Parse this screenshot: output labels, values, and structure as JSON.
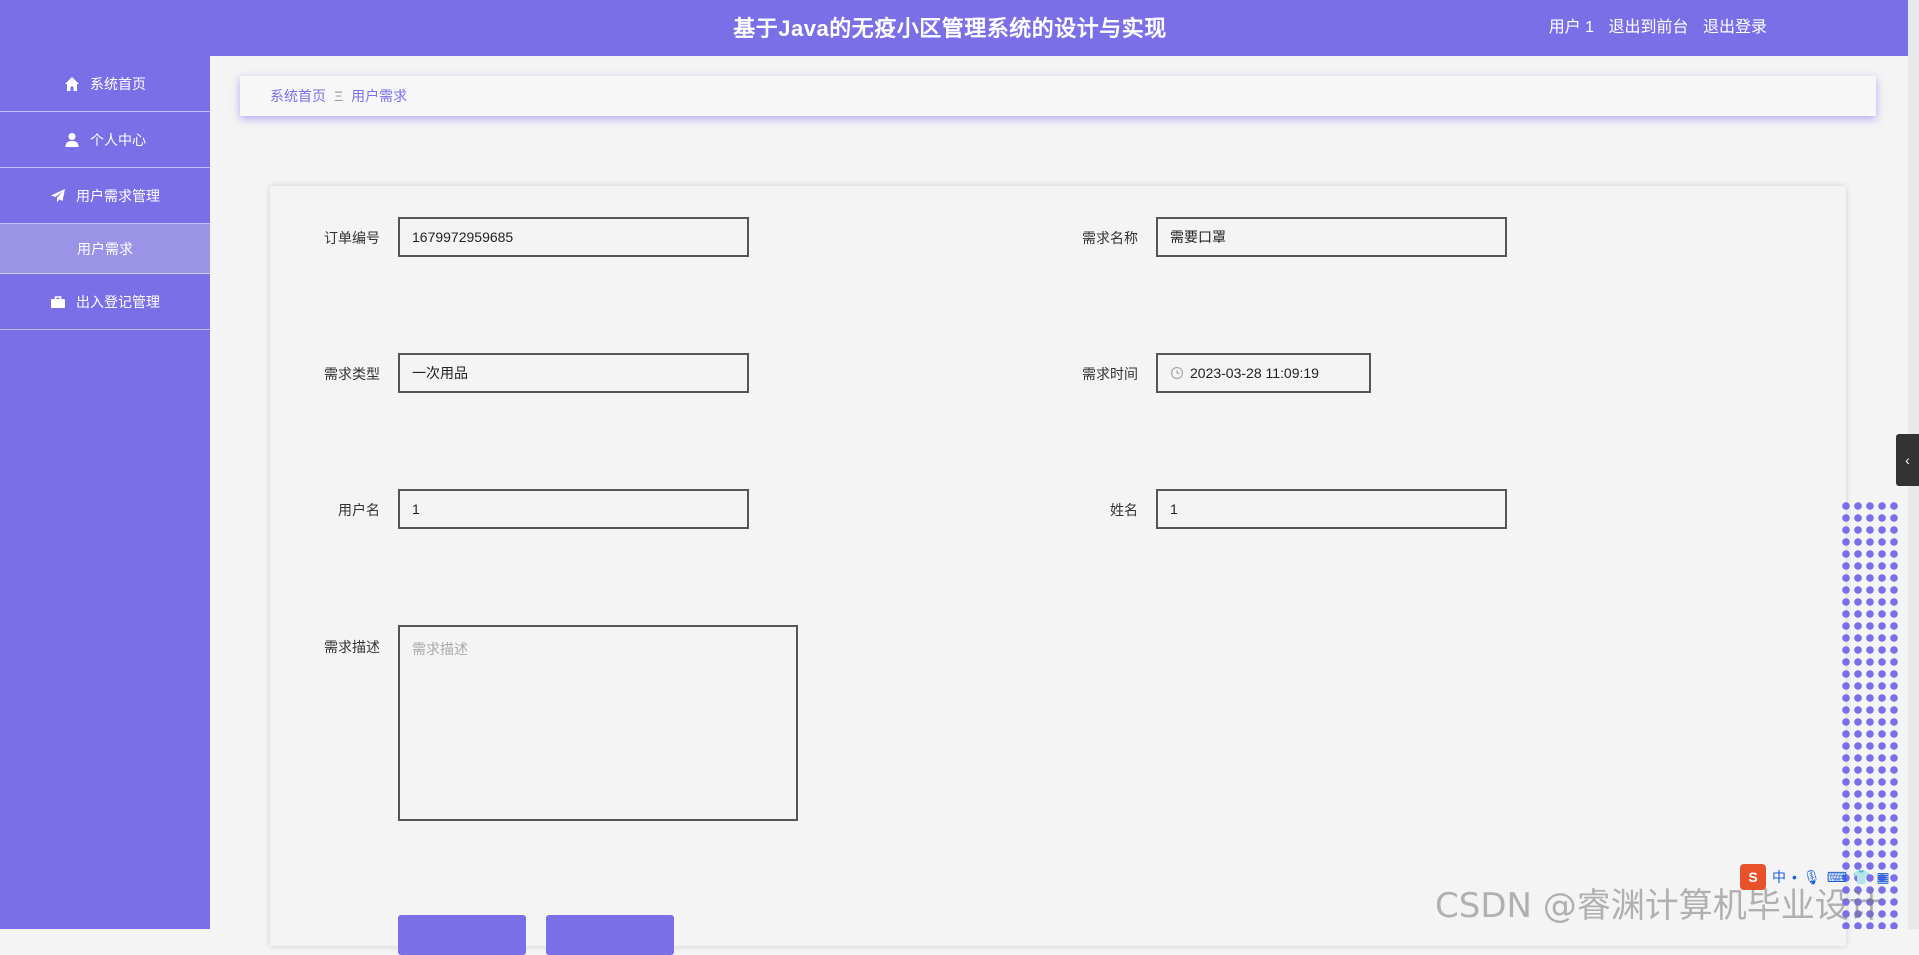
{
  "header": {
    "title": "基于Java的无疫小区管理系统的设计与实现",
    "user_label": "用户 1",
    "goto_front": "退出到前台",
    "logout": "退出登录"
  },
  "sidebar": {
    "items": [
      {
        "label": "系统首页",
        "icon": "home-icon"
      },
      {
        "label": "个人中心",
        "icon": "user-icon"
      },
      {
        "label": "用户需求管理",
        "icon": "paper-plane-icon"
      },
      {
        "label": "用户需求",
        "sub": true
      },
      {
        "label": "出入登记管理",
        "icon": "briefcase-icon"
      }
    ]
  },
  "breadcrumb": {
    "home": "系统首页",
    "separator": "Ξ",
    "current": "用户需求"
  },
  "form": {
    "order_no": {
      "label": "订单编号",
      "value": "1679972959685"
    },
    "demand_name": {
      "label": "需求名称",
      "value": "需要口罩"
    },
    "demand_type": {
      "label": "需求类型",
      "value": "一次用品"
    },
    "demand_time": {
      "label": "需求时间",
      "value": "2023-03-28 11:09:19"
    },
    "username": {
      "label": "用户名",
      "value": "1"
    },
    "name": {
      "label": "姓名",
      "value": "1"
    },
    "description": {
      "label": "需求描述",
      "placeholder": "需求描述"
    }
  },
  "watermark": "CSDN @睿渊计算机毕业设计",
  "ime": {
    "mode": "中"
  },
  "colors": {
    "accent": "#7b6fe8",
    "sub_active": "#9b93e6"
  }
}
